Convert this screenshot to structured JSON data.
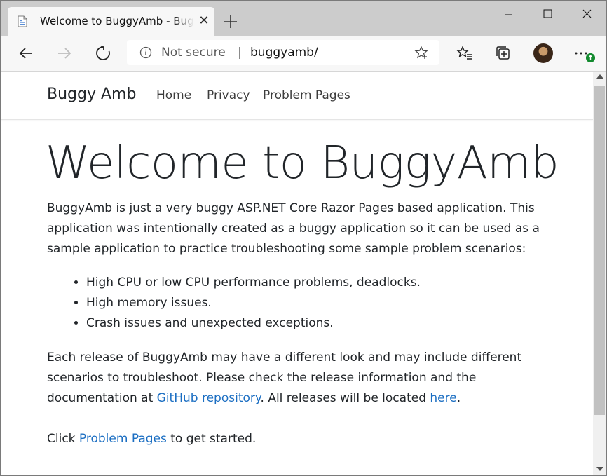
{
  "browser": {
    "tab_title": "Welcome to BuggyAmb - BuggyAmb",
    "address": {
      "security_label": "Not secure",
      "separator": "|",
      "url": "buggyamb/"
    },
    "icons": [
      "page-icon",
      "close-icon",
      "plus-icon",
      "minimize-icon",
      "maximize-icon",
      "close-window-icon",
      "back-arrow-icon",
      "forward-arrow-icon",
      "refresh-icon",
      "info-icon",
      "star-icon",
      "favorites-icon",
      "collections-icon",
      "profile-avatar",
      "more-icon",
      "update-badge-icon"
    ]
  },
  "site": {
    "brand": "Buggy Amb",
    "nav": [
      "Home",
      "Privacy",
      "Problem Pages"
    ]
  },
  "content": {
    "heading": "Welcome to BuggyAmb",
    "intro": "BuggyAmb is just a very buggy ASP.NET Core Razor Pages based application. This application was intentionally created as a buggy application so it can be used as a sample application to practice troubleshooting some sample problem scenarios:",
    "features": [
      "High CPU or low CPU performance problems, deadlocks.",
      "High memory issues.",
      "Crash issues and unexpected exceptions."
    ],
    "release_text_1": "Each release of BuggyAmb may have a different look and may include different scenarios to troubleshoot. Please check the release information and the documentation at ",
    "github_link": "GitHub repository",
    "release_text_2": ". All releases will be located ",
    "here_link": "here",
    "release_text_3": ".",
    "click_prefix": "Click ",
    "problem_pages_link": "Problem Pages",
    "click_suffix": " to get started."
  },
  "colors": {
    "link": "#1b6ec2",
    "titlebar": "#cccccc",
    "toolbar": "#f7f7f7",
    "badge": "#138a2f"
  }
}
